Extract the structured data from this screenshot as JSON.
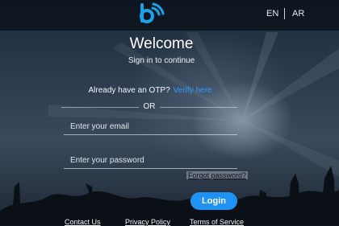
{
  "header": {
    "logo_icon": "brand-b-wifi-logo",
    "languages": [
      "EN",
      "AR"
    ]
  },
  "main": {
    "title": "Welcome",
    "subtitle": "Sign in to continue",
    "otp_prompt": "Already have an OTP?",
    "otp_link": "Verify here",
    "separator": "OR",
    "email": {
      "value": "",
      "placeholder": "Enter your email"
    },
    "password": {
      "value": "",
      "placeholder": "Enter your password"
    },
    "forgot_password": "Forgot password?",
    "login_label": "Login"
  },
  "footer": {
    "links": [
      "Contact Us",
      "Privacy Policy",
      "Terms of Service"
    ]
  },
  "colors": {
    "accent": "#1e93f5",
    "link": "#2f9bff",
    "logo": "#1aa3e8"
  }
}
